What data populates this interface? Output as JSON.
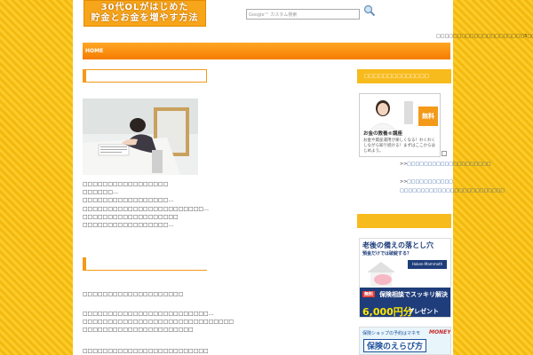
{
  "header": {
    "logo_line1": "30代OLがはじめた",
    "logo_line2": "貯金とお金を増やす方法",
    "search_placeholder": "Google™ カスタム検索",
    "ticker": "□□□□□□□□□□□□□□□□□□□□□5□□□□□□□□□□□"
  },
  "nav": {
    "home_label": "HOME"
  },
  "main": {
    "intro_lines": [
      "□□□□□□□□□□□□□□□□□",
      "□□□□□□…",
      "□□□□□□□□□□□□□□□□□…",
      "□□□□□□□□□□□□□□□□□□□□□□□□…",
      "□□□□□□□□□□□□□□□□□□□",
      "□□□□□□□□□□□□□□□□□…"
    ],
    "para1": "□□□□□□□□□□□□□□□□□□□□",
    "para2_lines": [
      "□□□□□□□□□□□□□□□□□□□□□□□□□…",
      "□□□□□□□□□□□□□□□□□□□□□□□□□□□□□□",
      "□□□□□□□□□□□□□□□□□□□□□□"
    ],
    "para3": "□□□□□□□□□□□□□□□□□□□□□□□□□"
  },
  "sidebar": {
    "title1": "□□□□□□□□□□□□□□",
    "ad1": {
      "free_label": "無料",
      "title": "お金の教養®講座",
      "desc": "お金や資産運用が楽しくなる！わくわくしながら知り続ける！まずはここからはじめよう。"
    },
    "arrow": ">>",
    "link1": "□□□□□□□□□□□□□□□□□□□□",
    "link2": "□□□□□□□□□□□",
    "link3": "□□□□□□□□□□□□□□□□□□□□□□□□□",
    "banner": {
      "headline": "老後の備えの落とし穴",
      "sub": "預金だけでは破綻する？",
      "logo": "Hoken-Mammoth",
      "tag": "無料",
      "cta": "保険相談でスッキリ解決",
      "price": "6,000円分",
      "present": "プレゼント"
    },
    "banner2": {
      "top": "保険ショップの予約はマネモ",
      "brand": "MONEY",
      "title": "保険のえらび方"
    }
  }
}
